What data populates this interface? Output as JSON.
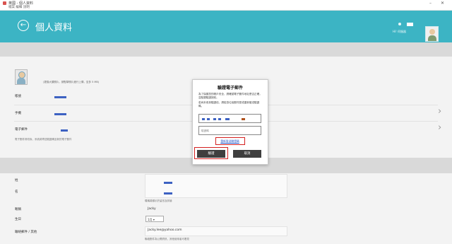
{
  "window": {
    "title": "英國 - 個人資料",
    "menu": "檔案 編輯 說明",
    "minimize_glyph": "–",
    "close_glyph": "✕"
  },
  "header": {
    "back_glyph": "←",
    "title": "個人資料",
    "tools_label": "Hi! 伺服器"
  },
  "profile": {
    "avatar_caption": "(更換大頭照片，請點擊照片進行上傳，至多 5 MB)",
    "rows": [
      {
        "label": "帳號"
      },
      {
        "label": "手機"
      },
      {
        "label": "電子郵件"
      }
    ],
    "email_note": "電子郵件修改後，系統將寄送驗證碼至新的電子郵件"
  },
  "details": {
    "surname_label": "姓",
    "given_label": "名",
    "nickname_label": "暱稱",
    "nickname_note": "暱稱將顯示於留言及評論",
    "nickname_value": "Jacky",
    "birthday_label": "生日",
    "birthday_value": "1月",
    "contact_label": "聯絡郵件 / 其他",
    "contact_value": "Jacky.lee@yahoo.com",
    "contact_note": "聯絡郵件為公開資訊，其他使用者可看見"
  },
  "modal": {
    "title": "驗證電子郵件",
    "description_1": "為了保護您的帳戶安全，請確認電子郵件地址是否正確，並點選驗證按鈕。",
    "description_2": "若尚未收到驗證信，請檢查垃圾郵件匣或重新發送驗證碼。",
    "code_placeholder": "驗證碼",
    "resend_label": "重新發送驗證碼",
    "verify_label": "驗證",
    "cancel_label": "取消"
  }
}
